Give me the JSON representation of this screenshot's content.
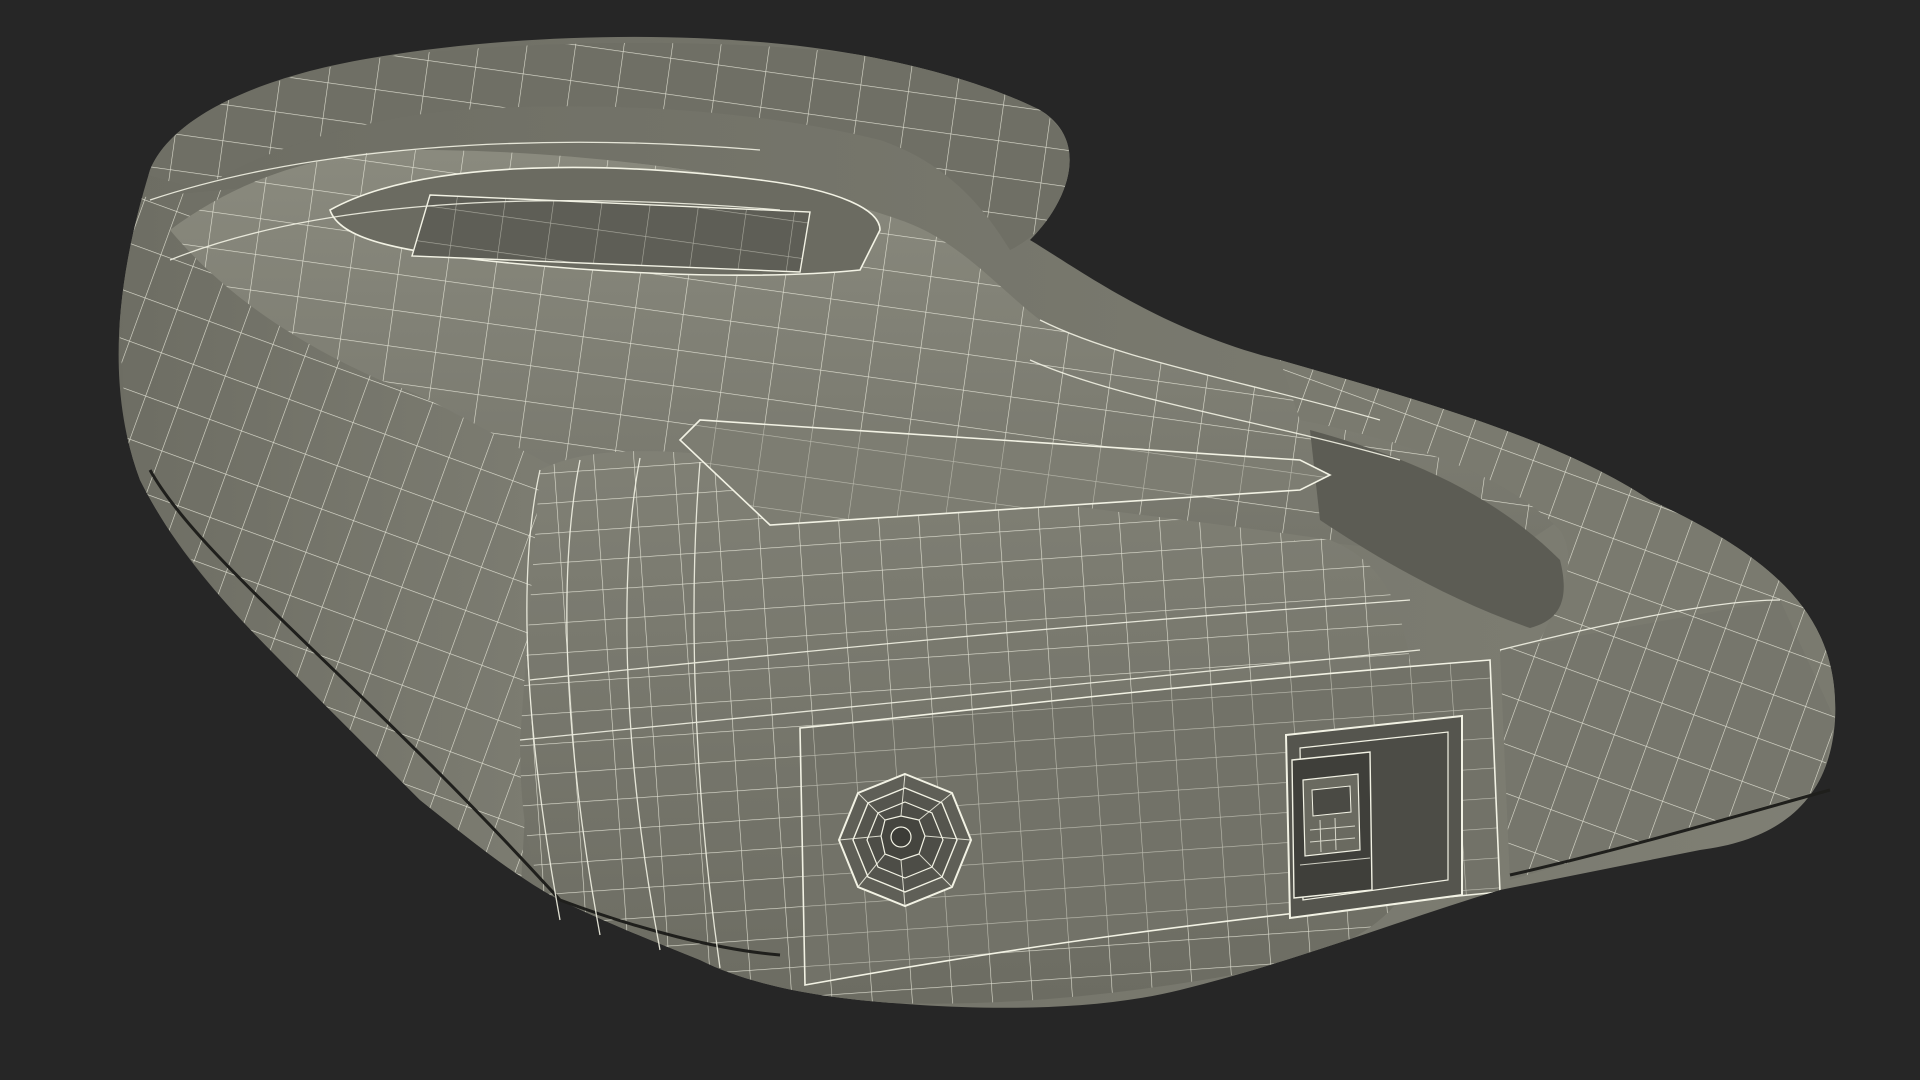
{
  "scene": {
    "subject": "",
    "colors": {
      "background": "#262626",
      "surface": "#7b7b70",
      "surface_light": "#868679",
      "surface_dark": "#6a6a60",
      "shadow": "#4f4f48",
      "wire": "#f2f2e4"
    },
    "icons": [
      "dc-power-jack-icon",
      "usb-b-port-icon"
    ]
  }
}
